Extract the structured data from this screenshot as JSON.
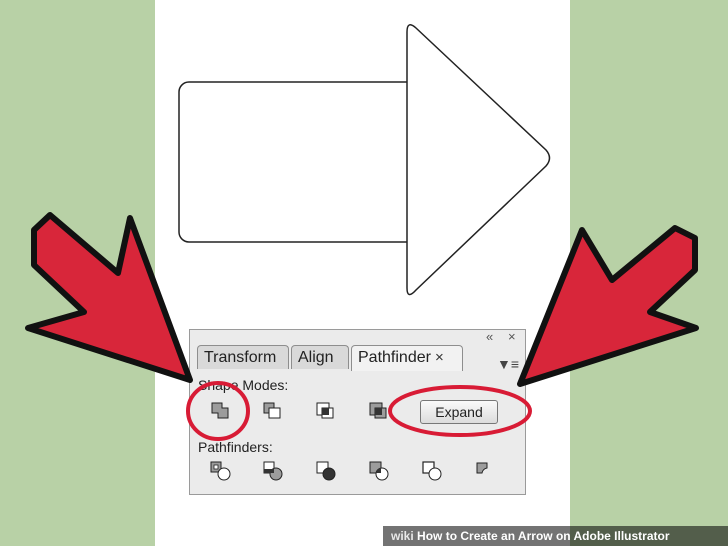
{
  "panel": {
    "tabs": [
      {
        "label": "Transform"
      },
      {
        "label": "Align"
      },
      {
        "label": "Pathfinder"
      }
    ],
    "active_tab_close": "×",
    "window_controls": {
      "collapse": "«",
      "close": "×"
    },
    "shape_modes_label": "Shape Modes:",
    "pathfinders_label": "Pathfinders:",
    "expand_label": "Expand"
  },
  "icons": {
    "shape_modes": [
      "unite-icon",
      "minus-front-icon",
      "intersect-icon",
      "exclude-icon"
    ],
    "pathfinders": [
      "divide-icon",
      "trim-icon",
      "merge-icon",
      "crop-icon",
      "outline-icon",
      "minus-back-icon"
    ]
  },
  "colors": {
    "arrow_red": "#d8263a",
    "highlight_red": "#d81b35",
    "background_green": "#b8d1a6"
  },
  "watermark": {
    "brand": "wiki",
    "title": "How to Create an Arrow on Adobe Illustrator"
  }
}
